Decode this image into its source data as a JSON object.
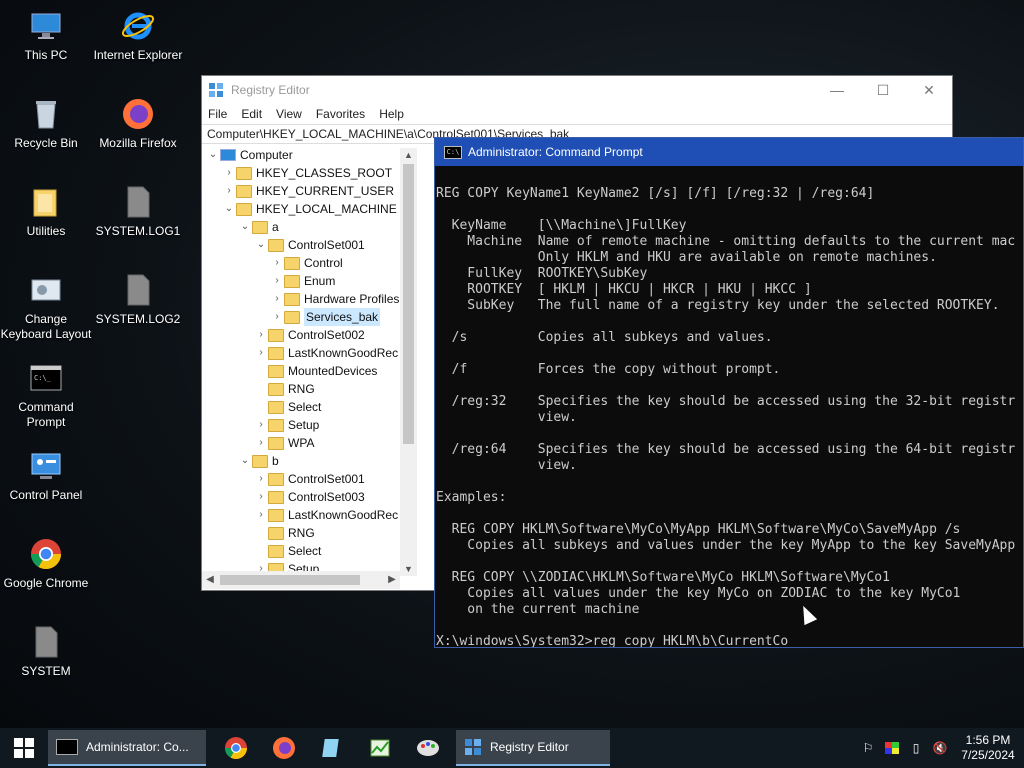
{
  "desktop": {
    "icons": [
      {
        "label": "This PC",
        "icon": "this-pc-icon"
      },
      {
        "label": "Internet Explorer",
        "icon": "internet-explorer-icon"
      },
      {
        "label": "Recycle Bin",
        "icon": "recycle-bin-icon"
      },
      {
        "label": "Mozilla Firefox",
        "icon": "firefox-icon"
      },
      {
        "label": "Utilities",
        "icon": "folder-icon"
      },
      {
        "label": "SYSTEM.LOG1",
        "icon": "file-icon"
      },
      {
        "label": "Change Keyboard Layout",
        "icon": "keyboard-icon"
      },
      {
        "label": "SYSTEM.LOG2",
        "icon": "file-icon"
      },
      {
        "label": "Command Prompt",
        "icon": "cmd-icon"
      },
      {
        "label": "Control Panel",
        "icon": "control-panel-icon"
      },
      {
        "label": "Google Chrome",
        "icon": "chrome-icon"
      },
      {
        "label": "SYSTEM",
        "icon": "file-icon"
      }
    ]
  },
  "regedit": {
    "title": "Registry Editor",
    "menu": [
      "File",
      "Edit",
      "View",
      "Favorites",
      "Help"
    ],
    "address": "Computer\\HKEY_LOCAL_MACHINE\\a\\ControlSet001\\Services_bak",
    "tree": [
      {
        "name": "Computer",
        "chev": "⌄"
      },
      {
        "name": "HKEY_CLASSES_ROOT",
        "chev": "›"
      },
      {
        "name": "HKEY_CURRENT_USER",
        "chev": "›"
      },
      {
        "name": "HKEY_LOCAL_MACHINE",
        "chev": "⌄"
      },
      {
        "name": "a",
        "chev": "⌄"
      },
      {
        "name": "ControlSet001",
        "chev": "⌄"
      },
      {
        "name": "Control",
        "chev": "›"
      },
      {
        "name": "Enum",
        "chev": "›"
      },
      {
        "name": "Hardware Profiles",
        "chev": "›"
      },
      {
        "name": "Services_bak",
        "chev": "›",
        "selected": true
      },
      {
        "name": "ControlSet002",
        "chev": "›"
      },
      {
        "name": "LastKnownGoodRec",
        "chev": "›"
      },
      {
        "name": "MountedDevices",
        "chev": ""
      },
      {
        "name": "RNG",
        "chev": ""
      },
      {
        "name": "Select",
        "chev": ""
      },
      {
        "name": "Setup",
        "chev": "›"
      },
      {
        "name": "WPA",
        "chev": "›"
      },
      {
        "name": "b",
        "chev": "⌄"
      },
      {
        "name": "ControlSet001",
        "chev": "›"
      },
      {
        "name": "ControlSet003",
        "chev": "›"
      },
      {
        "name": "LastKnownGoodRec",
        "chev": "›"
      },
      {
        "name": "RNG",
        "chev": ""
      },
      {
        "name": "Select",
        "chev": ""
      },
      {
        "name": "Setup",
        "chev": "›"
      }
    ]
  },
  "cmd": {
    "title": "Administrator: Command Prompt",
    "lines": [
      "",
      "REG COPY KeyName1 KeyName2 [/s] [/f] [/reg:32 | /reg:64]",
      "",
      "  KeyName    [\\\\Machine\\]FullKey",
      "    Machine  Name of remote machine - omitting defaults to the current mac",
      "             Only HKLM and HKU are available on remote machines.",
      "    FullKey  ROOTKEY\\SubKey",
      "    ROOTKEY  [ HKLM | HKCU | HKCR | HKU | HKCC ]",
      "    SubKey   The full name of a registry key under the selected ROOTKEY.",
      "",
      "  /s         Copies all subkeys and values.",
      "",
      "  /f         Forces the copy without prompt.",
      "",
      "  /reg:32    Specifies the key should be accessed using the 32-bit registr",
      "             view.",
      "",
      "  /reg:64    Specifies the key should be accessed using the 64-bit registr",
      "             view.",
      "",
      "Examples:",
      "",
      "  REG COPY HKLM\\Software\\MyCo\\MyApp HKLM\\Software\\MyCo\\SaveMyApp /s",
      "    Copies all subkeys and values under the key MyApp to the key SaveMyApp",
      "",
      "  REG COPY \\\\ZODIAC\\HKLM\\Software\\MyCo HKLM\\Software\\MyCo1",
      "    Copies all values under the key MyCo on ZODIAC to the key MyCo1",
      "    on the current machine",
      "",
      "X:\\windows\\System32>reg copy HKLM\\b\\CurrentCo"
    ]
  },
  "taskbar": {
    "tasks": [
      {
        "label": "Administrator: Co...",
        "icon": "cmd-icon"
      },
      {
        "label": "Registry Editor",
        "icon": "registry-editor-icon"
      }
    ],
    "pinned": [
      "chrome-icon",
      "firefox-icon",
      "notepad-icon",
      "task-manager-icon",
      "paint-icon"
    ],
    "time": "1:56 PM",
    "date": "7/25/2024"
  }
}
